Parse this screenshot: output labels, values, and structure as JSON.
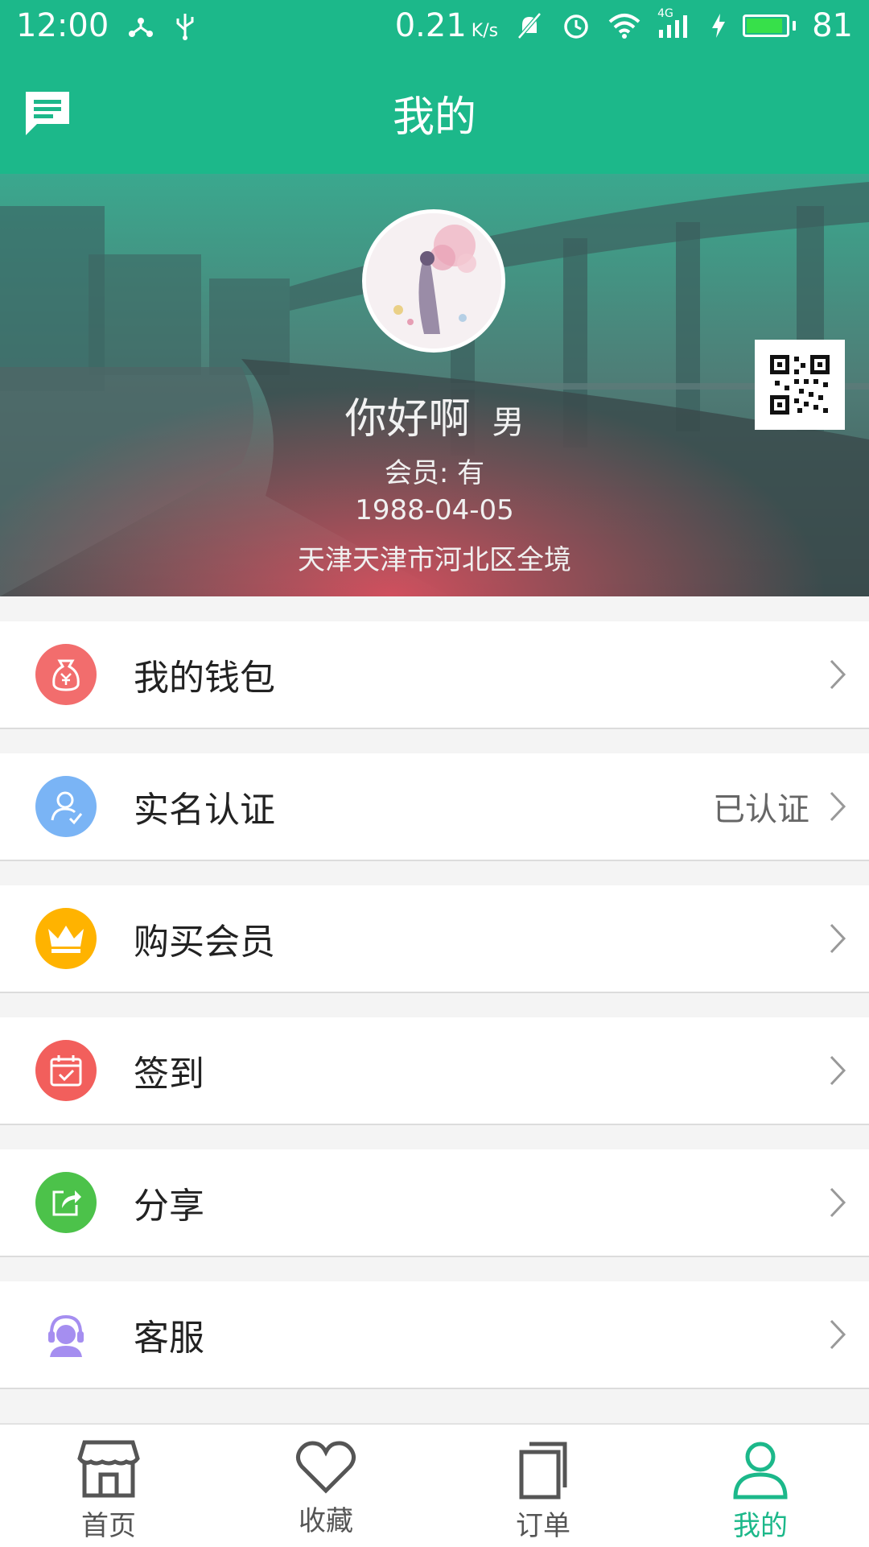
{
  "status_bar": {
    "time": "12:00",
    "net_speed": "0.21",
    "net_unit": "K/s",
    "network_type": "4G",
    "battery_level": "81"
  },
  "header": {
    "title": "我的",
    "message_icon": "message-icon"
  },
  "profile": {
    "name": "你好啊",
    "gender": "男",
    "membership": "会员: 有",
    "birthday": "1988-04-05",
    "location": "天津天津市河北区全境"
  },
  "menu": [
    {
      "label": "我的钱包",
      "value": "",
      "icon": "wallet-icon",
      "color": "#f26d6d"
    },
    {
      "label": "实名认证",
      "value": "已认证",
      "icon": "verified-user-icon",
      "color": "#7ab4f5"
    },
    {
      "label": "购买会员",
      "value": "",
      "icon": "crown-icon",
      "color": "#ffb300"
    },
    {
      "label": "签到",
      "value": "",
      "icon": "calendar-check-icon",
      "color": "#f25f5c"
    },
    {
      "label": "分享",
      "value": "",
      "icon": "share-icon",
      "color": "#4cc24a"
    },
    {
      "label": "客服",
      "value": "",
      "icon": "customer-service-icon",
      "color": "#a58ef0"
    }
  ],
  "tabs": [
    {
      "label": "首页",
      "icon": "store-icon",
      "active": false
    },
    {
      "label": "收藏",
      "icon": "heart-icon",
      "active": false
    },
    {
      "label": "订单",
      "icon": "orders-icon",
      "active": false
    },
    {
      "label": "我的",
      "icon": "user-icon",
      "active": true
    }
  ],
  "colors": {
    "brand": "#1cb88a",
    "tab_inactive": "#555555"
  }
}
